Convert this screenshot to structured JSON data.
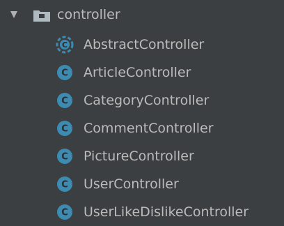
{
  "tree": {
    "folder": {
      "name": "controller",
      "expanded": true,
      "icon": "package-folder-icon"
    },
    "items": [
      {
        "label": "AbstractController",
        "icon": "abstract-class-icon"
      },
      {
        "label": "ArticleController",
        "icon": "class-icon"
      },
      {
        "label": "CategoryController",
        "icon": "class-icon"
      },
      {
        "label": "CommentController",
        "icon": "class-icon"
      },
      {
        "label": "PictureController",
        "icon": "class-icon"
      },
      {
        "label": "UserController",
        "icon": "class-icon"
      },
      {
        "label": "UserLikeDislikeController",
        "icon": "class-icon"
      }
    ]
  },
  "colors": {
    "background": "#3c3f41",
    "text": "#bbbbbb",
    "class_icon": "#3d8bb0",
    "folder_icon": "#aeb9c0"
  }
}
